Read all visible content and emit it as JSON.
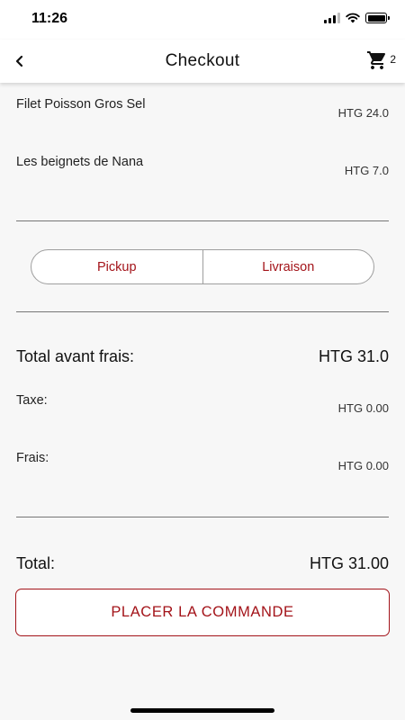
{
  "status_bar": {
    "time": "11:26"
  },
  "nav": {
    "title": "Checkout",
    "cart_count": "2"
  },
  "items": [
    {
      "name": "Filet Poisson Gros Sel",
      "price": "HTG 24.0"
    },
    {
      "name": "Les beignets de Nana",
      "price": "HTG 7.0"
    }
  ],
  "delivery_options": [
    "Pickup",
    "Livraison"
  ],
  "summary": {
    "subtotal_label": "Total avant frais:",
    "subtotal_value": "HTG 31.0",
    "tax_label": "Taxe:",
    "tax_value": "HTG 0.00",
    "fees_label": "Frais:",
    "fees_value": "HTG 0.00",
    "total_label": "Total:",
    "total_value": "HTG 31.00"
  },
  "place_order_label": "PLACER LA COMMANDE",
  "colors": {
    "accent": "#a31319",
    "background": "#f7f7f7"
  },
  "icons": {
    "back": "chevron-left-icon",
    "cart": "shopping-cart-icon"
  }
}
